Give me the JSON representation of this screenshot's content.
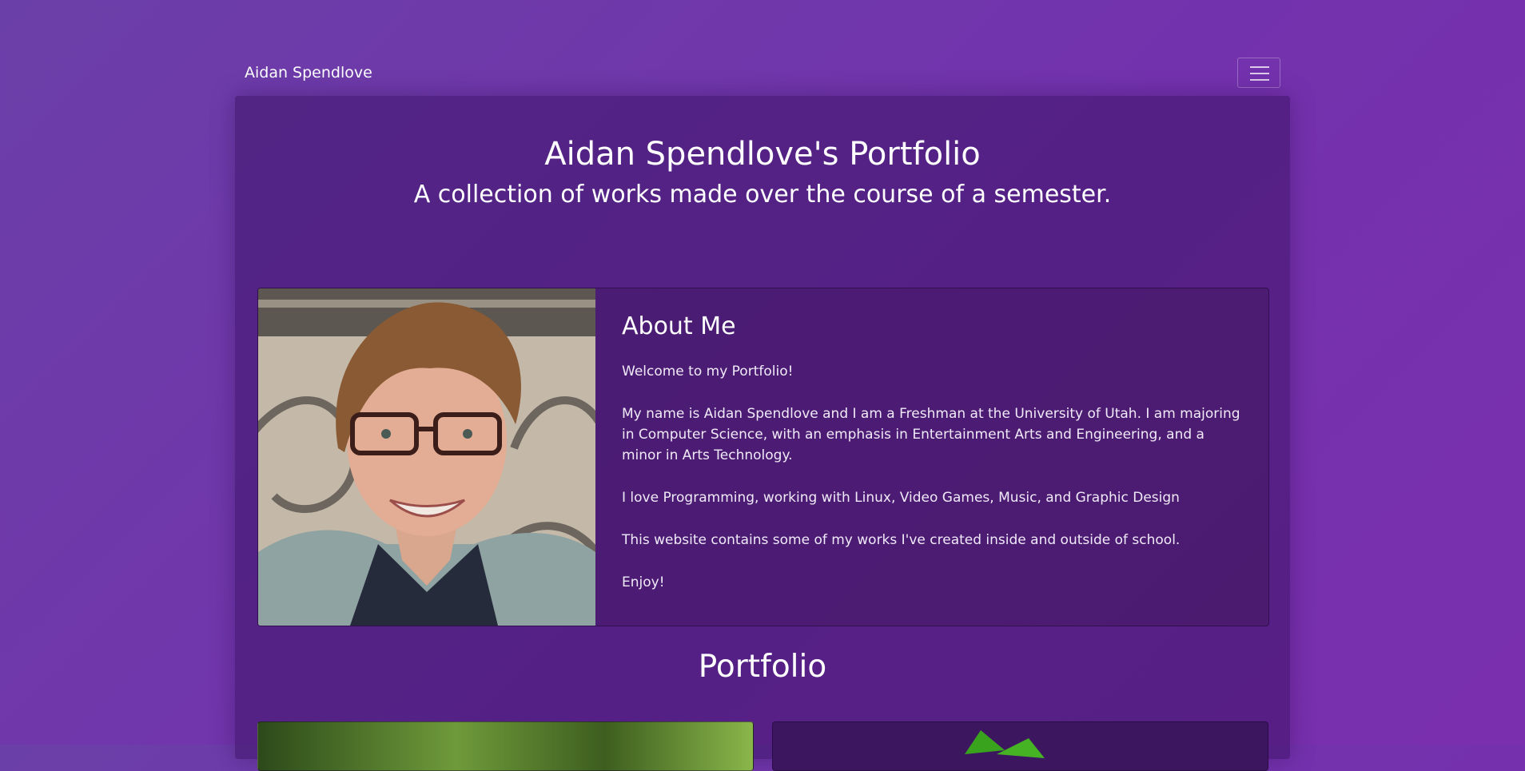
{
  "nav": {
    "brand": "Aidan Spendlove",
    "toggle_icon": "hamburger-menu-icon"
  },
  "hero": {
    "title": "Aidan Spendlove's Portfolio",
    "subtitle": "A collection of works made over the course of a semester."
  },
  "about": {
    "title": "About Me",
    "paragraphs": [
      "Welcome to my Portfolio!",
      "My name is Aidan Spendlove and I am a Freshman at the University of Utah. I am majoring in Computer Science, with an emphasis in Entertainment Arts and Engineering, and a minor in Arts Technology.",
      "I love Programming, working with Linux, Video Games, Music, and Graphic Design",
      "This website contains some of my works I've created inside and outside of school.",
      "Enjoy!"
    ]
  },
  "portfolio": {
    "title": "Portfolio"
  },
  "colors": {
    "background": "#7332ad",
    "container": "#4e1f78",
    "card": "#4a1d72",
    "text": "#ffffff"
  }
}
